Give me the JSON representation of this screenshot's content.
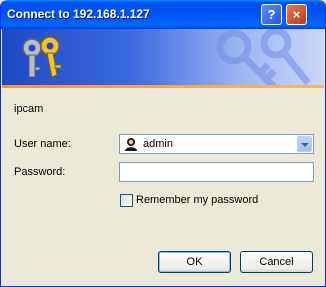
{
  "window": {
    "title": "Connect to 192.168.1.127",
    "help_label": "?",
    "close_label": "×"
  },
  "realm": "ipcam",
  "form": {
    "username_label": "User name:",
    "username_value": "admin",
    "password_label": "Password:",
    "password_value": "",
    "remember_label": "Remember my password",
    "remember_checked": false
  },
  "buttons": {
    "ok": "OK",
    "cancel": "Cancel"
  },
  "colors": {
    "titlebar": "#0053EE",
    "banner": "#3B6AE0",
    "accent_line": "#F59433"
  }
}
